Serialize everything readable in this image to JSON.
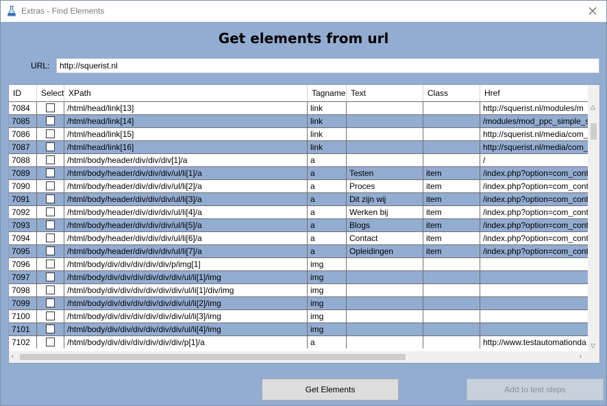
{
  "window": {
    "title": "Extras - Find Elements"
  },
  "heading": "Get elements from url",
  "url": {
    "label": "URL:",
    "value": "http://squerist.nl"
  },
  "table": {
    "columns": [
      "ID",
      "Select",
      "XPath",
      "Tagname",
      "Text",
      "Class",
      "Href"
    ],
    "rows": [
      {
        "id": "7084",
        "xpath": "/html/head/link[13]",
        "tag": "link",
        "text": "",
        "class": "",
        "href": "http://squerist.nl/modules/m"
      },
      {
        "id": "7085",
        "xpath": "/html/head/link[14]",
        "tag": "link",
        "text": "",
        "class": "",
        "href": "/modules/mod_ppc_simple_s"
      },
      {
        "id": "7086",
        "xpath": "/html/head/link[15]",
        "tag": "link",
        "text": "",
        "class": "",
        "href": "http://squerist.nl/media/com_"
      },
      {
        "id": "7087",
        "xpath": "/html/head/link[16]",
        "tag": "link",
        "text": "",
        "class": "",
        "href": "http://squerist.nl/media/com_"
      },
      {
        "id": "7088",
        "xpath": "/html/body/header/div/div/div[1]/a",
        "tag": "a",
        "text": "",
        "class": "",
        "href": "/"
      },
      {
        "id": "7089",
        "xpath": "/html/body/header/div/div/div/ul/li[1]/a",
        "tag": "a",
        "text": "Testen",
        "class": "item",
        "href": "/index.php?option=com_cont"
      },
      {
        "id": "7090",
        "xpath": "/html/body/header/div/div/div/ul/li[2]/a",
        "tag": "a",
        "text": "Proces",
        "class": "item",
        "href": "/index.php?option=com_cont"
      },
      {
        "id": "7091",
        "xpath": "/html/body/header/div/div/div/ul/li[3]/a",
        "tag": "a",
        "text": "Dit zijn wij",
        "class": "item",
        "href": "/index.php?option=com_cont"
      },
      {
        "id": "7092",
        "xpath": "/html/body/header/div/div/div/ul/li[4]/a",
        "tag": "a",
        "text": "Werken bij",
        "class": "item",
        "href": "/index.php?option=com_cont"
      },
      {
        "id": "7093",
        "xpath": "/html/body/header/div/div/div/ul/li[5]/a",
        "tag": "a",
        "text": "Blogs",
        "class": "item",
        "href": "/index.php?option=com_cont"
      },
      {
        "id": "7094",
        "xpath": "/html/body/header/div/div/div/ul/li[6]/a",
        "tag": "a",
        "text": "Contact",
        "class": "item",
        "href": "/index.php?option=com_cont"
      },
      {
        "id": "7095",
        "xpath": "/html/body/header/div/div/div/ul/li[7]/a",
        "tag": "a",
        "text": "Opleidingen",
        "class": "item",
        "href": "/index.php?option=com_cont"
      },
      {
        "id": "7096",
        "xpath": "/html/body/div/div/div/div/div/p/img[1]",
        "tag": "img",
        "text": "",
        "class": "",
        "href": ""
      },
      {
        "id": "7097",
        "xpath": "/html/body/div/div/div/div/div/div/ul/li[1]/img",
        "tag": "img",
        "text": "",
        "class": "",
        "href": ""
      },
      {
        "id": "7098",
        "xpath": "/html/body/div/div/div/div/div/div/ul/li[1]/div/img",
        "tag": "img",
        "text": "",
        "class": "",
        "href": ""
      },
      {
        "id": "7099",
        "xpath": "/html/body/div/div/div/div/div/div/ul/li[2]/img",
        "tag": "img",
        "text": "",
        "class": "",
        "href": ""
      },
      {
        "id": "7100",
        "xpath": "/html/body/div/div/div/div/div/div/ul/li[3]/img",
        "tag": "img",
        "text": "",
        "class": "",
        "href": ""
      },
      {
        "id": "7101",
        "xpath": "/html/body/div/div/div/div/div/div/ul/li[4]/img",
        "tag": "img",
        "text": "",
        "class": "",
        "href": ""
      },
      {
        "id": "7102",
        "xpath": "/html/body/div/div/div/div/div/div/p[1]/a",
        "tag": "a",
        "text": "",
        "class": "",
        "href": "http://www.testautomationda"
      }
    ]
  },
  "buttons": {
    "get": "Get Elements",
    "add": "Add to test steps"
  },
  "icons": {
    "app": "flask-icon",
    "close": "close-icon"
  }
}
